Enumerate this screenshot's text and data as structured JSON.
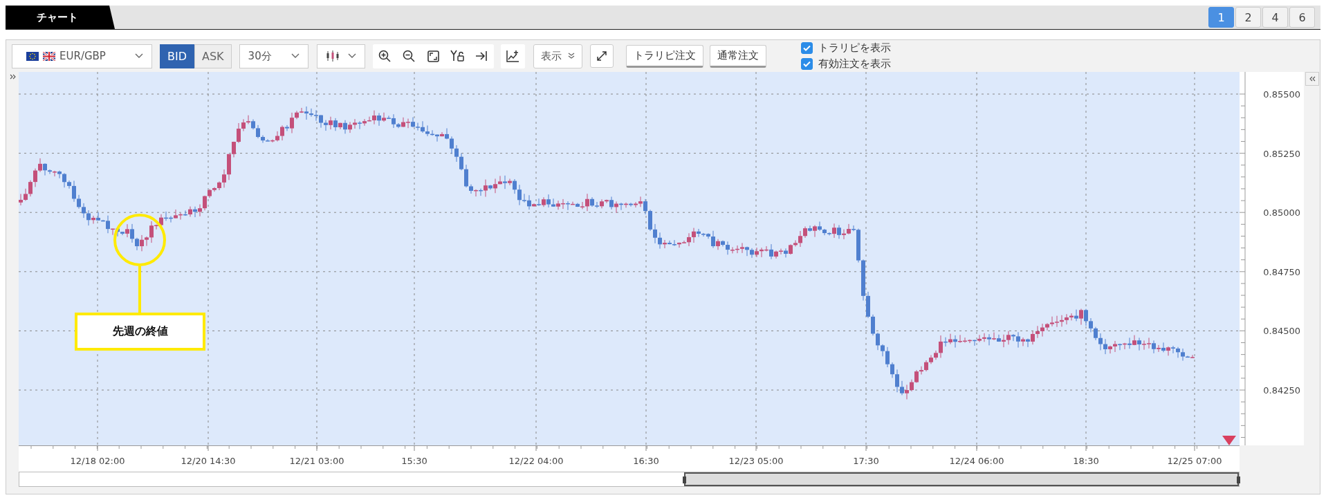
{
  "tab": {
    "label": "チャート"
  },
  "layout_buttons": [
    {
      "label": "1",
      "selected": true
    },
    {
      "label": "2",
      "selected": false
    },
    {
      "label": "4",
      "selected": false
    },
    {
      "label": "6",
      "selected": false
    }
  ],
  "toolbar": {
    "pair": "EUR/GBP",
    "price_side": [
      {
        "label": "BID",
        "selected": true
      },
      {
        "label": "ASK",
        "selected": false
      }
    ],
    "timeframe": "30分",
    "display_menu": "表示",
    "order_buttons": [
      "トラリピ注文",
      "通常注文"
    ],
    "options": [
      {
        "label": "トラリピを表示",
        "checked": true
      },
      {
        "label": "有効注文を表示",
        "checked": true
      }
    ]
  },
  "chart": {
    "y_labels": [
      "0.85500",
      "0.85250",
      "0.85000",
      "0.84750",
      "0.84500",
      "0.84250"
    ],
    "x_labels": [
      "12/18 02:00",
      "12/20 14:30",
      "12/21 03:00",
      "15:30",
      "12/22 04:00",
      "16:30",
      "12/23 05:00",
      "17:30",
      "12/24 06:00",
      "18:30",
      "12/25 07:00"
    ],
    "callout": "先週の終値"
  }
}
